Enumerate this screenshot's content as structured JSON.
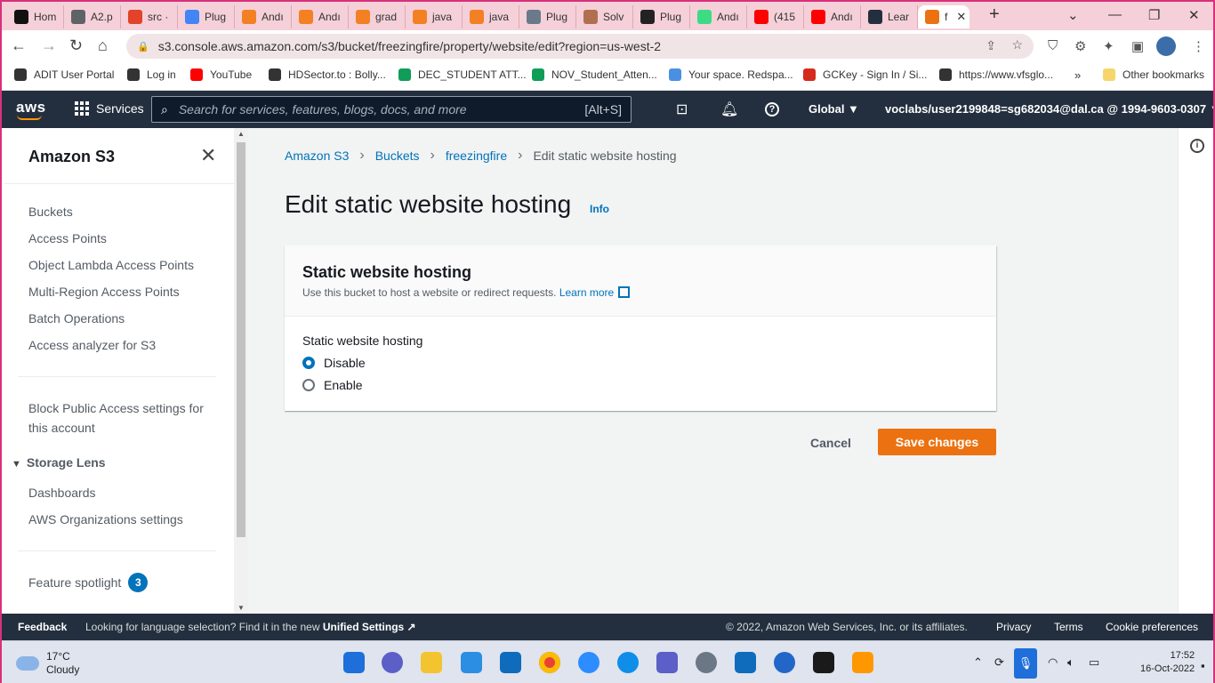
{
  "browser": {
    "tabs": [
      {
        "label": "Hom",
        "icon": "d2l-icon",
        "color": "#111111"
      },
      {
        "label": "A2.p",
        "icon": "globe-icon",
        "color": "#5f6368"
      },
      {
        "label": "src ·",
        "icon": "gitlab-icon",
        "color": "#e24329"
      },
      {
        "label": "Plug",
        "icon": "google-icon",
        "color": "#4285f4"
      },
      {
        "label": "Andı",
        "icon": "stackoverflow-icon",
        "color": "#f48024"
      },
      {
        "label": "Andı",
        "icon": "stackoverflow-icon",
        "color": "#f48024"
      },
      {
        "label": "grad",
        "icon": "stackoverflow-icon",
        "color": "#f48024"
      },
      {
        "label": "java",
        "icon": "stackoverflow-icon",
        "color": "#f48024"
      },
      {
        "label": "java",
        "icon": "stackoverflow-icon",
        "color": "#f48024"
      },
      {
        "label": "Plug",
        "icon": "bug-icon",
        "color": "#6a7a8a"
      },
      {
        "label": "Solv",
        "icon": "avatar-icon",
        "color": "#b07050"
      },
      {
        "label": "Plug",
        "icon": "github-icon",
        "color": "#222222"
      },
      {
        "label": "Andı",
        "icon": "android-icon",
        "color": "#3ddc84"
      },
      {
        "label": "(415",
        "icon": "youtube-icon",
        "color": "#ff0000"
      },
      {
        "label": "Andı",
        "icon": "youtube-icon",
        "color": "#ff0000"
      },
      {
        "label": "Lear",
        "icon": "aws-icon",
        "color": "#232f3e"
      },
      {
        "label": "f",
        "icon": "s3-cube-icon",
        "color": "#ec7211"
      }
    ],
    "url": "s3.console.aws.amazon.com/s3/bucket/freezingfire/property/website/edit?region=us-west-2",
    "bookmarks": [
      {
        "label": "ADIT User Portal",
        "color": "#333333"
      },
      {
        "label": "Log in",
        "color": "#333333"
      },
      {
        "label": "YouTube",
        "color": "#ff0000"
      },
      {
        "label": "HDSector.to : Bolly...",
        "color": "#333333"
      },
      {
        "label": "DEC_STUDENT ATT...",
        "color": "#0f9d58"
      },
      {
        "label": "NOV_Student_Atten...",
        "color": "#0f9d58"
      },
      {
        "label": "Your space. Redspa...",
        "color": "#4a90e2"
      },
      {
        "label": "GCKey - Sign In / Si...",
        "color": "#d52b1e"
      },
      {
        "label": "https://www.vfsglo...",
        "color": "#333333"
      }
    ],
    "more_bookmarks": "»",
    "other_bookmarks": "Other bookmarks"
  },
  "aws_header": {
    "logo": "aws",
    "services": "Services",
    "search_placeholder": "Search for services, features, blogs, docs, and more",
    "search_shortcut": "[Alt+S]",
    "region": "Global ▼",
    "account": "voclabs/user2199848=sg682034@dal.ca @ 1994-9603-0307 ▼"
  },
  "sidebar": {
    "title": "Amazon S3",
    "items": [
      "Buckets",
      "Access Points",
      "Object Lambda Access Points",
      "Multi-Region Access Points",
      "Batch Operations",
      "Access analyzer for S3"
    ],
    "block_public_access": "Block Public Access settings for this account",
    "storage_lens": {
      "heading": "Storage Lens",
      "items": [
        "Dashboards",
        "AWS Organizations settings"
      ]
    },
    "feature_spotlight": {
      "label": "Feature spotlight",
      "count": "3"
    }
  },
  "breadcrumb": [
    "Amazon S3",
    "Buckets",
    "freezingfire",
    "Edit static website hosting"
  ],
  "page": {
    "title": "Edit static website hosting",
    "info": "Info"
  },
  "panel": {
    "title": "Static website hosting",
    "description": "Use this bucket to host a website or redirect requests.",
    "learn_more": "Learn more",
    "field_label": "Static website hosting",
    "options": [
      {
        "label": "Disable",
        "selected": true
      },
      {
        "label": "Enable",
        "selected": false
      }
    ]
  },
  "actions": {
    "cancel": "Cancel",
    "save": "Save changes"
  },
  "footer": {
    "feedback": "Feedback",
    "language_prefix": "Looking for language selection? Find it in the new",
    "unified_settings": "Unified Settings",
    "copyright": "© 2022, Amazon Web Services, Inc. or its affiliates.",
    "privacy": "Privacy",
    "terms": "Terms",
    "cookies": "Cookie preferences"
  },
  "taskbar": {
    "temperature": "17°C",
    "condition": "Cloudy",
    "time": "17:52",
    "date": "16-Oct-2022"
  },
  "colors": {
    "aws_dark": "#232f3e",
    "link": "#0073bb",
    "primary_button": "#ec7211",
    "browser_accent": "#d9307a"
  }
}
